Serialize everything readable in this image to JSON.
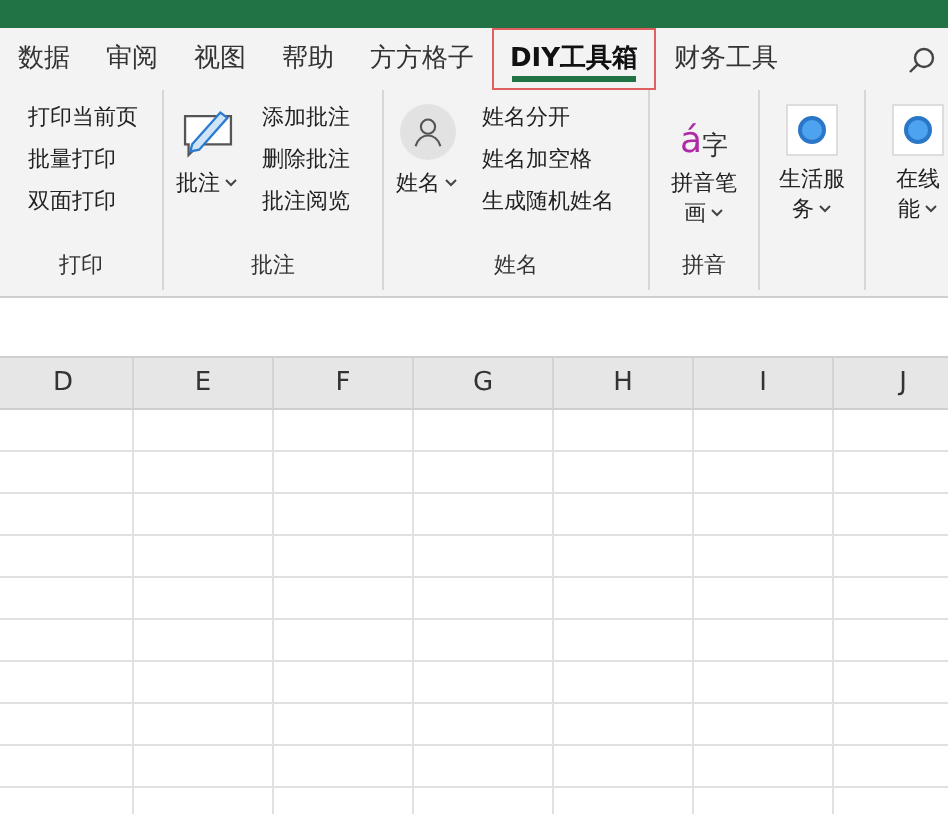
{
  "tabs": [
    {
      "label": "数据",
      "selected": false,
      "highlighted": false
    },
    {
      "label": "审阅",
      "selected": false,
      "highlighted": false
    },
    {
      "label": "视图",
      "selected": false,
      "highlighted": false
    },
    {
      "label": "帮助",
      "selected": false,
      "highlighted": false
    },
    {
      "label": "方方格子",
      "selected": false,
      "highlighted": false
    },
    {
      "label": "DIY工具箱",
      "selected": true,
      "highlighted": true
    },
    {
      "label": "财务工具",
      "selected": false,
      "highlighted": false
    }
  ],
  "ribbon_groups": [
    {
      "kind": "print",
      "label": "打印",
      "items": [
        "打印当前页",
        "批量打印",
        "双面打印"
      ]
    },
    {
      "kind": "note",
      "label": "批注",
      "big": {
        "lines": [
          "批注"
        ]
      },
      "items": [
        "添加批注",
        "删除批注",
        "批注阅览"
      ]
    },
    {
      "kind": "name",
      "label": "姓名",
      "big": {
        "lines": [
          "姓名"
        ]
      },
      "items": [
        "姓名分开",
        "姓名加空格",
        "生成随机姓名"
      ]
    },
    {
      "kind": "pinyin",
      "label": "拼音",
      "big": {
        "lines": [
          "拼音笔",
          "画"
        ],
        "glyph_a": "á",
        "glyph_b": "字"
      }
    },
    {
      "kind": "service",
      "big": {
        "lines": [
          "生活服",
          "务"
        ]
      }
    },
    {
      "kind": "service",
      "big": {
        "lines": [
          "在线",
          "能"
        ]
      }
    }
  ],
  "columns": [
    "D",
    "E",
    "F",
    "G",
    "H",
    "I",
    "J"
  ]
}
